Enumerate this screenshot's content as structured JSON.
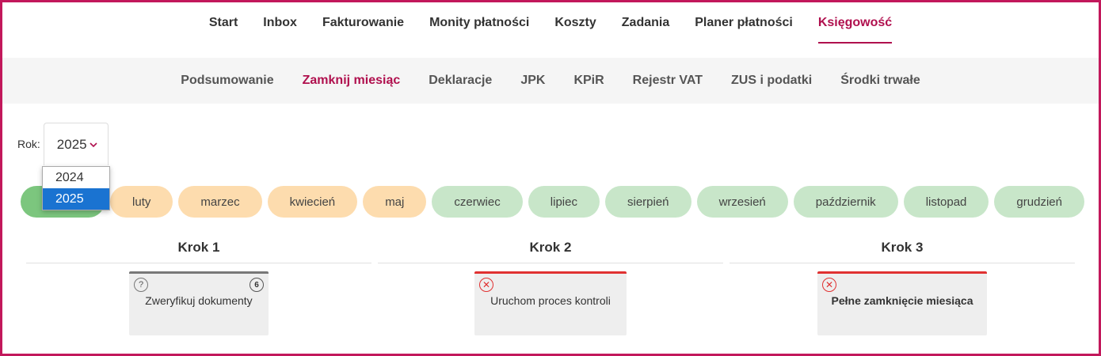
{
  "top_nav": [
    "Start",
    "Inbox",
    "Fakturowanie",
    "Monity płatności",
    "Koszty",
    "Zadania",
    "Planer płatności",
    "Księgowość"
  ],
  "top_nav_active": "Księgowość",
  "sub_nav": [
    "Podsumowanie",
    "Zamknij miesiąc",
    "Deklaracje",
    "JPK",
    "KPiR",
    "Rejestr VAT",
    "ZUS i podatki",
    "Środki trwałe"
  ],
  "sub_nav_active": "Zamknij miesiąc",
  "year": {
    "label": "Rok:",
    "value": "2025",
    "options": [
      "2024",
      "2025"
    ],
    "selected": "2025"
  },
  "months": [
    {
      "label": "",
      "status": "done"
    },
    {
      "label": "luty",
      "status": "warn"
    },
    {
      "label": "marzec",
      "status": "warn"
    },
    {
      "label": "kwiecień",
      "status": "warn"
    },
    {
      "label": "maj",
      "status": "warn"
    },
    {
      "label": "czerwiec",
      "status": "future"
    },
    {
      "label": "lipiec",
      "status": "future"
    },
    {
      "label": "sierpień",
      "status": "future"
    },
    {
      "label": "wrzesień",
      "status": "future"
    },
    {
      "label": "październik",
      "status": "future"
    },
    {
      "label": "listopad",
      "status": "future"
    },
    {
      "label": "grudzień",
      "status": "future"
    }
  ],
  "steps": [
    {
      "title": "Krok 1",
      "card": {
        "text": "Zweryfikuj dokumenty",
        "icon": "question-icon",
        "badge": "6",
        "state": "neutral",
        "bold": false
      }
    },
    {
      "title": "Krok 2",
      "card": {
        "text": "Uruchom proces kontroli",
        "icon": "error-icon",
        "badge": "",
        "state": "error",
        "bold": false
      }
    },
    {
      "title": "Krok 3",
      "card": {
        "text": "Pełne zamknięcie miesiąca",
        "icon": "error-icon",
        "badge": "",
        "state": "error",
        "bold": true
      }
    }
  ],
  "colors": {
    "accent": "#b0104e",
    "done": "#7cc67e",
    "warn": "#fddcae",
    "future": "#c8e6c9",
    "error": "#e03131",
    "select_highlight": "#1a73d1"
  }
}
